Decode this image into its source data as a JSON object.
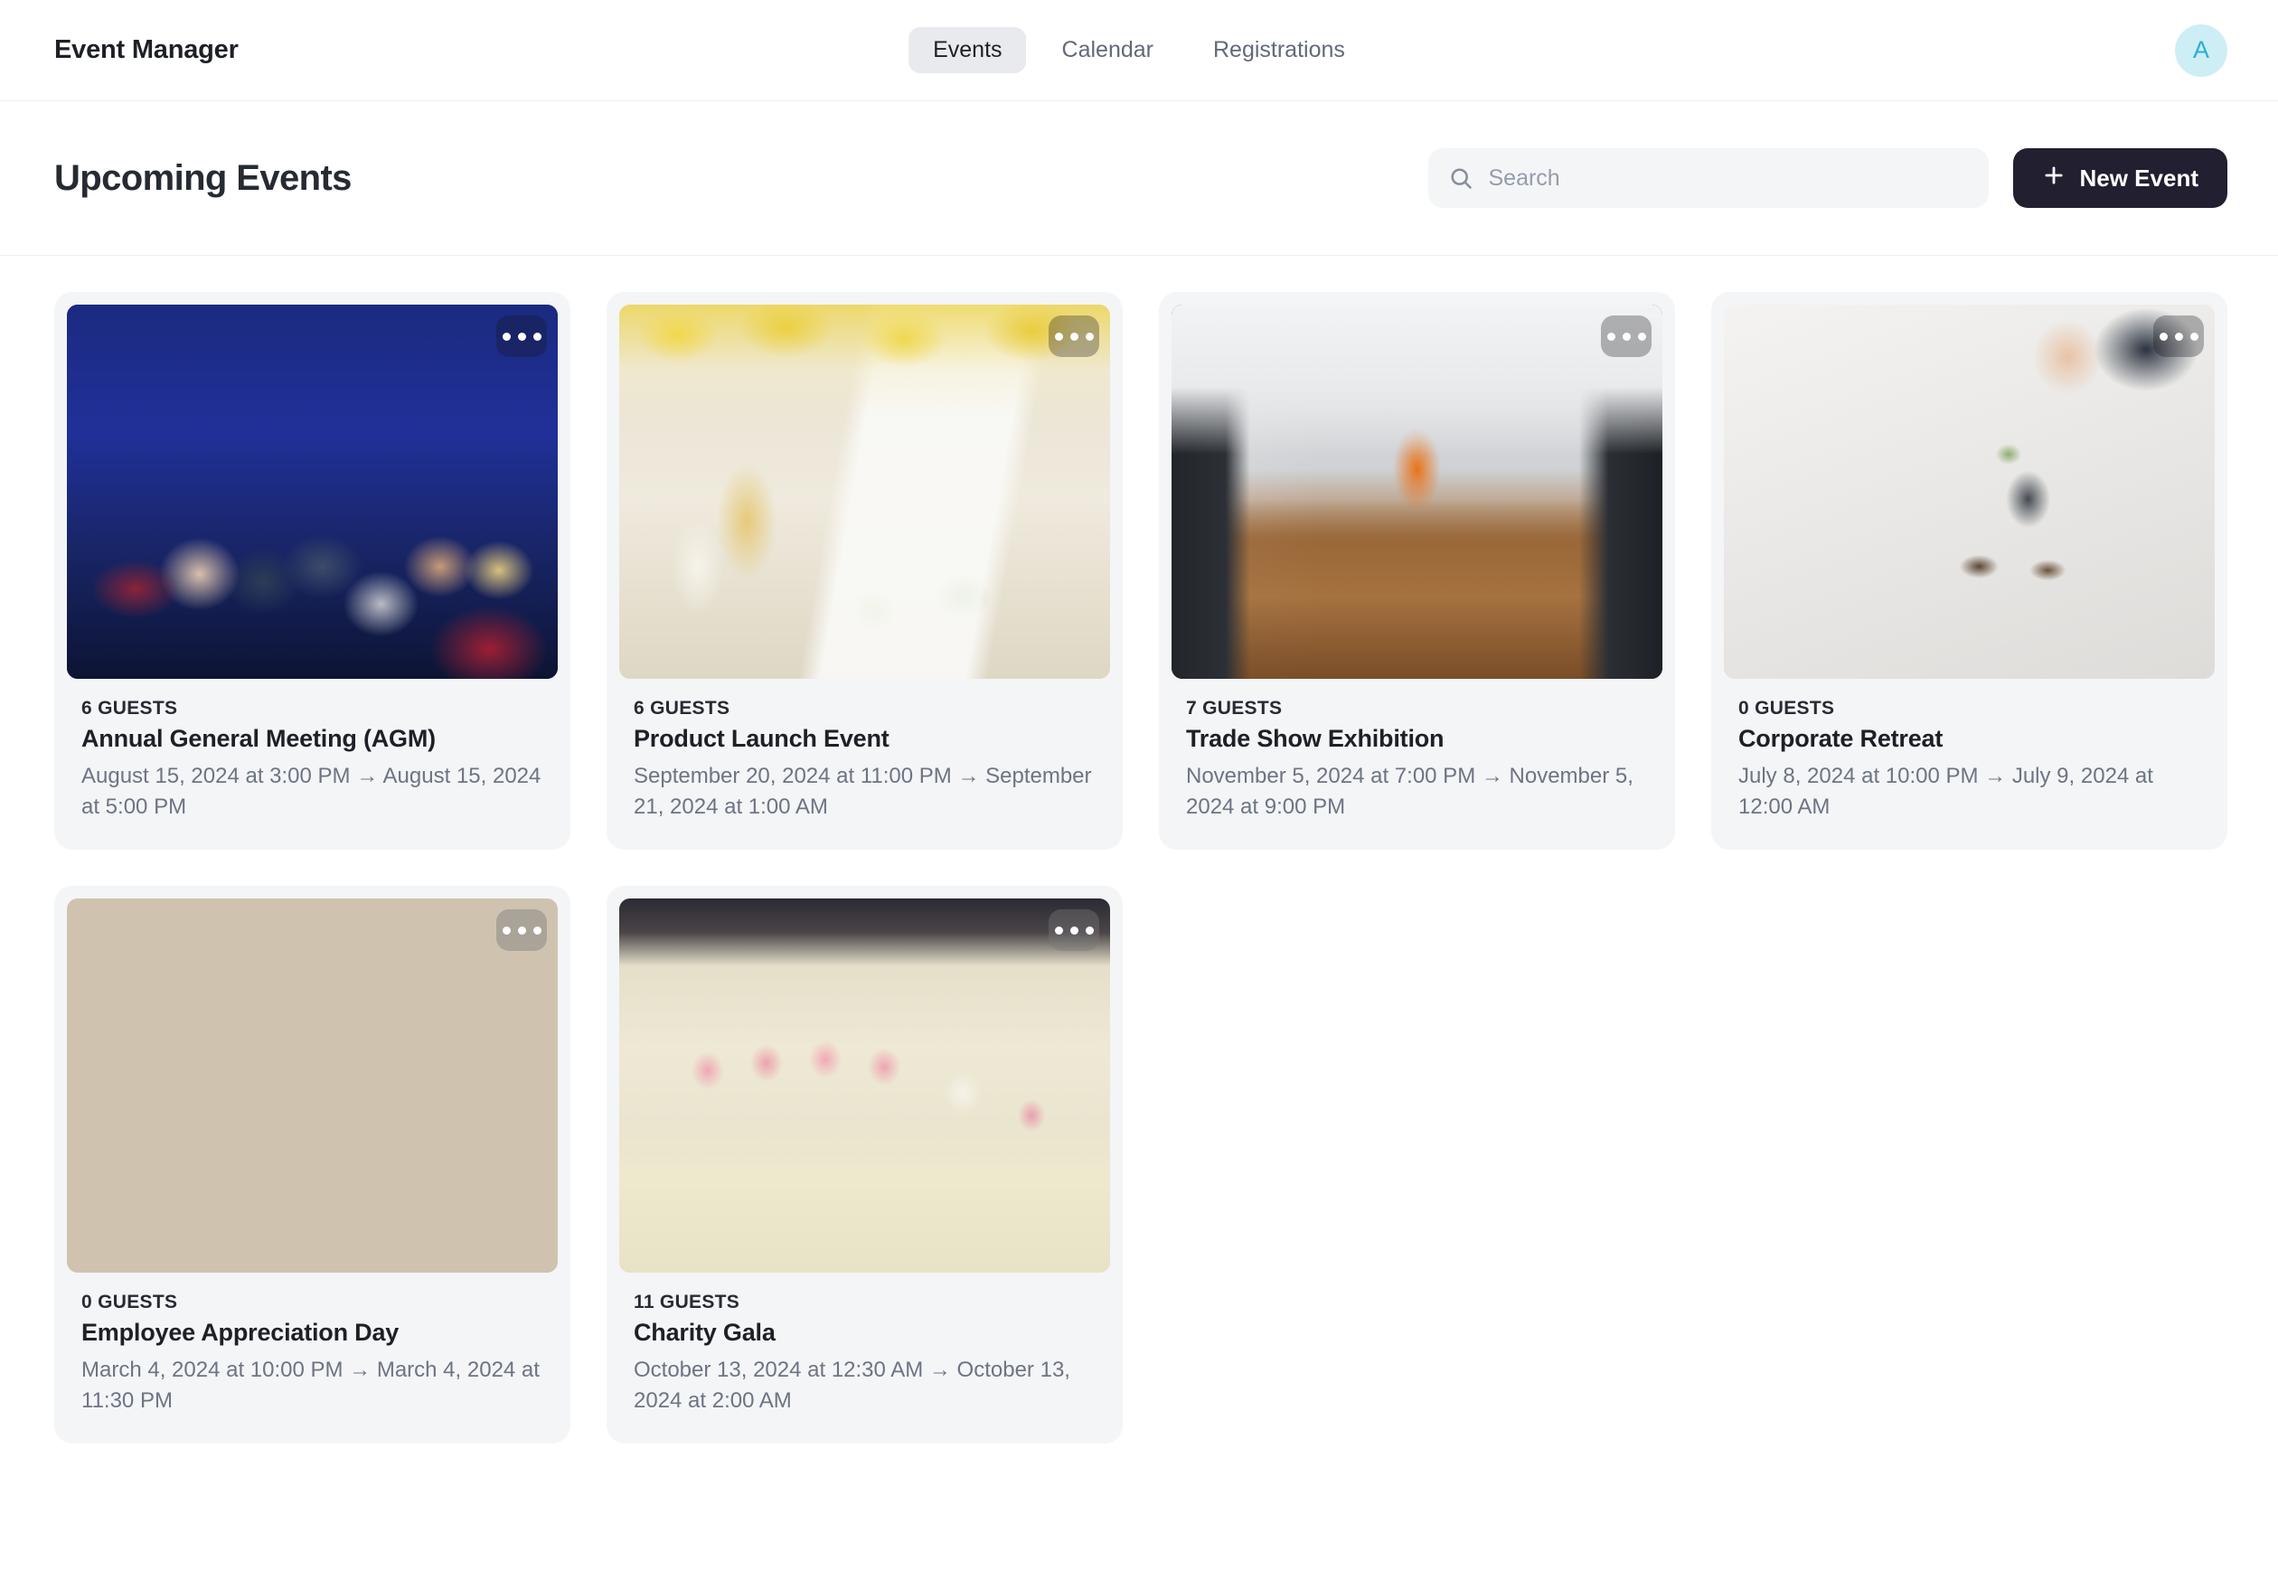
{
  "topnav": {
    "brand": "Event Manager",
    "tabs": [
      {
        "label": "Events",
        "active": true
      },
      {
        "label": "Calendar",
        "active": false
      },
      {
        "label": "Registrations",
        "active": false
      }
    ],
    "avatar_initial": "A",
    "avatar_bg": "#cdeef4",
    "avatar_fg": "#29afd4"
  },
  "subheader": {
    "page_title": "Upcoming Events",
    "search": {
      "value": "",
      "placeholder": "Search",
      "icon": "search-icon"
    },
    "new_event_button": {
      "label": "New Event",
      "icon": "plus-icon",
      "bg": "#211f30",
      "fg": "#ffffff"
    }
  },
  "events": [
    {
      "guests": "6 GUESTS",
      "title": "Annual General Meeting (AGM)",
      "date_start": "August 15, 2024 at 3:00 PM",
      "arrow": "→",
      "date_end": "August 15, 2024 at 5:00 PM",
      "photo": "photo-agm",
      "photo_alt": "audience seated in dark blue auditorium",
      "menu_icon": "more-options-icon",
      "menu_tone": "dark"
    },
    {
      "guests": "6 GUESTS",
      "title": "Product Launch Event",
      "date_start": "September 20, 2024 at 11:00 PM",
      "arrow": "→",
      "date_end": "September 21, 2024 at 1:00 AM",
      "photo": "photo-soap",
      "photo_alt": "cucumber curd and mint soap product with jars and yellow flowers",
      "menu_icon": "more-options-icon",
      "menu_tone": "dark"
    },
    {
      "guests": "7 GUESTS",
      "title": "Trade Show Exhibition",
      "date_start": "November 5, 2024 at 7:00 PM",
      "arrow": "→",
      "date_end": "November 5, 2024 at 9:00 PM",
      "photo": "photo-tradeshow",
      "photo_alt": "gallery hall with artwork and wooden floor",
      "menu_icon": "more-options-icon",
      "menu_tone": "dark"
    },
    {
      "guests": "0 GUESTS",
      "title": "Corporate Retreat",
      "date_start": "July 8, 2024 at 10:00 PM",
      "arrow": "→",
      "date_end": "July 9, 2024 at 12:00 AM",
      "photo": "photo-retreat",
      "photo_alt": "sunglasses and succulent planter on a white table",
      "menu_icon": "more-options-icon",
      "menu_tone": "dark"
    },
    {
      "guests": "0 GUESTS",
      "title": "Employee Appreciation Day",
      "date_start": "March 4, 2024 at 10:00 PM",
      "arrow": "→",
      "date_end": "March 4, 2024 at 11:30 PM",
      "photo": "photo-office",
      "photo_alt": "colleagues collaborating with laptops at a meeting table",
      "menu_icon": "more-options-icon",
      "menu_tone": "light"
    },
    {
      "guests": "11 GUESTS",
      "title": "Charity Gala",
      "date_start": "October 13, 2024 at 12:30 AM",
      "arrow": "→",
      "date_end": "October 13, 2024 at 2:00 AM",
      "photo": "photo-gala",
      "photo_alt": "banquet table set with pink napkins and floral centerpieces",
      "menu_icon": "more-options-icon",
      "menu_tone": "light"
    }
  ]
}
